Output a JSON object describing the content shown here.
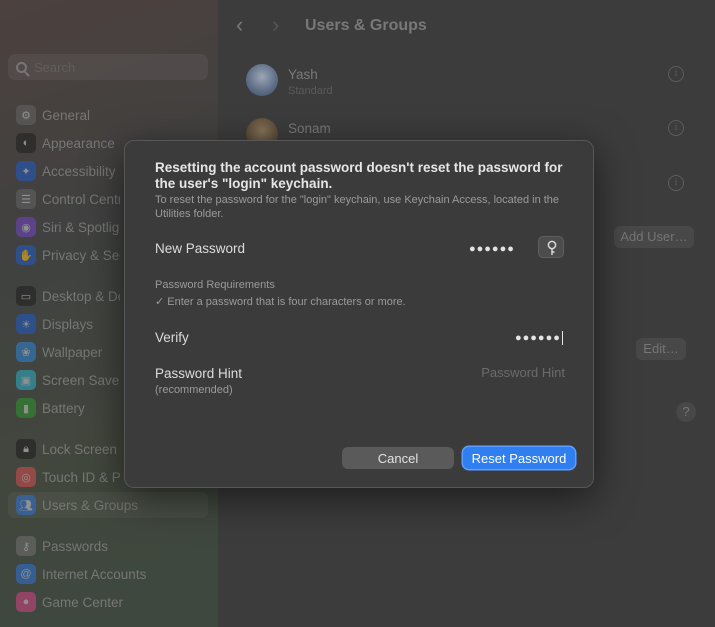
{
  "sidebar": {
    "search_placeholder": "Search",
    "items": [
      {
        "label": "General",
        "icon": "gear-icon",
        "color": "#6d6d6d"
      },
      {
        "label": "Appearance",
        "icon": "appearance-icon",
        "color": "#2e2e2e"
      },
      {
        "label": "Accessibility",
        "icon": "accessibility-icon",
        "color": "#2f65c9"
      },
      {
        "label": "Control Centre",
        "icon": "control-centre-icon",
        "color": "#6d6d6d"
      },
      {
        "label": "Siri & Spotlight",
        "icon": "siri-icon",
        "color": "#7a4fc5"
      },
      {
        "label": "Privacy & Security",
        "icon": "hand-icon",
        "color": "#2f65c9"
      },
      {
        "label": "Desktop & Dock",
        "icon": "dock-icon",
        "color": "#2e2e2e"
      },
      {
        "label": "Displays",
        "icon": "display-icon",
        "color": "#2f65c9"
      },
      {
        "label": "Wallpaper",
        "icon": "wallpaper-icon",
        "color": "#3b8ad6"
      },
      {
        "label": "Screen Saver",
        "icon": "screen-saver-icon",
        "color": "#3bb3c9"
      },
      {
        "label": "Battery",
        "icon": "battery-icon",
        "color": "#3a9a3a"
      },
      {
        "label": "Lock Screen",
        "icon": "lock-icon",
        "color": "#2e2e2e"
      },
      {
        "label": "Touch ID & Password",
        "icon": "fingerprint-icon",
        "color": "#d65a5a"
      },
      {
        "label": "Users & Groups",
        "icon": "users-icon",
        "color": "#3b7bd6"
      },
      {
        "label": "Passwords",
        "icon": "key-icon",
        "color": "#7a7a7a"
      },
      {
        "label": "Internet Accounts",
        "icon": "at-icon",
        "color": "#3b7bd6"
      },
      {
        "label": "Game Center",
        "icon": "game-center-icon",
        "color": "#d64f8a"
      }
    ]
  },
  "main": {
    "title": "Users & Groups",
    "users": [
      {
        "name": "Yash",
        "role": "Standard"
      },
      {
        "name": "Sonam",
        "role": ""
      }
    ],
    "add_user_label": "Add User…",
    "edit_label": "Edit…",
    "help_label": "?"
  },
  "dialog": {
    "heading": "Resetting the account password doesn't reset the password for the user's \"login\" keychain.",
    "subtext": "To reset the password for the \"login\" keychain, use Keychain Access, located in the Utilities folder.",
    "new_password_label": "New Password",
    "new_password_value": "●●●●●●",
    "requirements_title": "Password Requirements",
    "requirement": "✓ Enter a password that is four characters or more.",
    "verify_label": "Verify",
    "verify_value": "●●●●●●",
    "hint_label": "Password Hint",
    "hint_sub": "(recommended)",
    "hint_placeholder": "Password Hint",
    "cancel_label": "Cancel",
    "reset_label": "Reset Password"
  },
  "colors": {
    "accent": "#2f7ff0",
    "dialog_bg": "#3b3b3b"
  }
}
